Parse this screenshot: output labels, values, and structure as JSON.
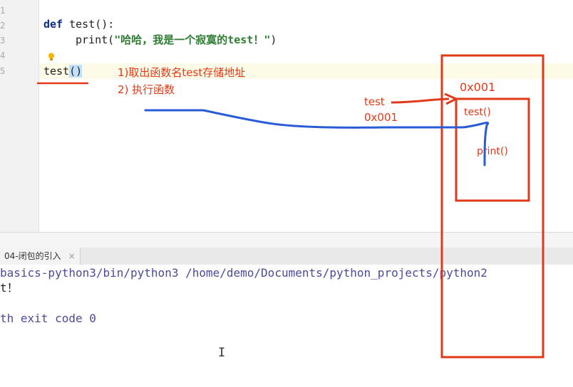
{
  "editor": {
    "line_numbers": [
      "1",
      "2",
      "3",
      "4",
      "5"
    ],
    "code": {
      "def_kw": "def",
      "def_sig": " test():",
      "print_fn": "print(",
      "print_str": "\"哈哈，我是一个寂寞的test！\"",
      "print_close": ")",
      "call_name": "test",
      "call_parens": "()"
    }
  },
  "annotations": {
    "step1": "1)取出函数名test存储地址",
    "step2": "2) 执行函数",
    "var_name": "test",
    "var_addr": "0x001",
    "box_addr": "0x001",
    "box_func": "test()",
    "box_print": "print()"
  },
  "bottom_panel": {
    "tab_label": "04-闭包的引入",
    "tab_close": "×"
  },
  "console": {
    "line1": "basics-python3/bin/python3 /home/demo/Documents/python_projects/python2",
    "line2": "t！",
    "line3": "",
    "line4": "th exit code 0"
  },
  "colors": {
    "annotation_red": "#e03a1a",
    "annotation_blue": "#2a5bd7"
  },
  "cursor_icon": "text-cursor-icon"
}
